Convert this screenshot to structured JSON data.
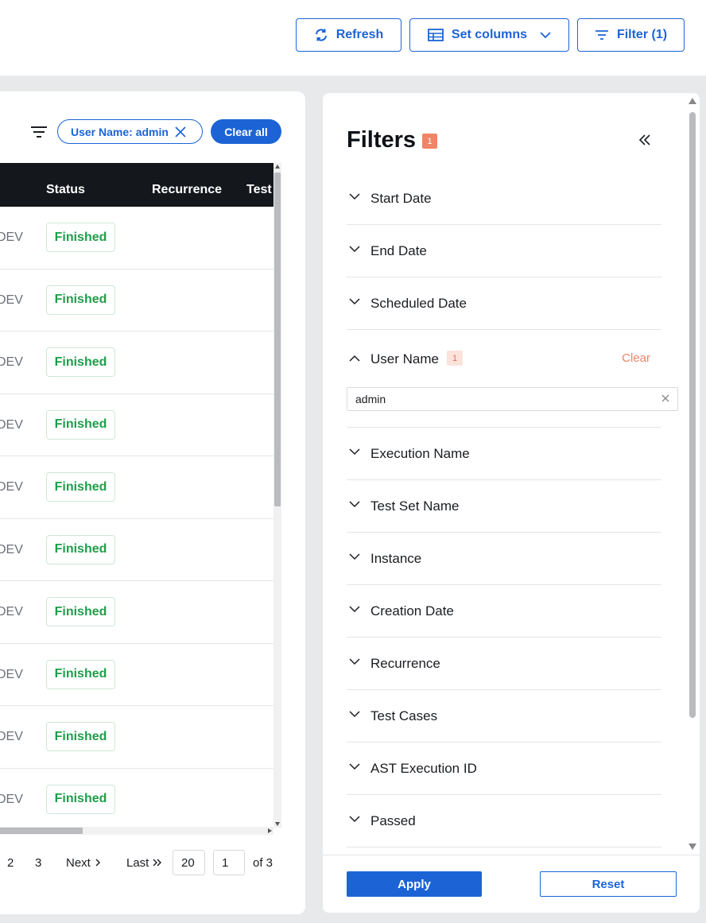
{
  "toolbar": {
    "refresh_label": "Refresh",
    "set_columns_label": "Set columns",
    "filter_label": "Filter (1)"
  },
  "table": {
    "active_filter_chip": "User Name: admin",
    "clear_all_label": "Clear all",
    "columns": [
      "Status",
      "Recurrence",
      "Test"
    ],
    "rows": [
      {
        "instance": "DEV",
        "status": "Finished"
      },
      {
        "instance": "DEV",
        "status": "Finished"
      },
      {
        "instance": "DEV",
        "status": "Finished"
      },
      {
        "instance": "DEV",
        "status": "Finished"
      },
      {
        "instance": "DEV",
        "status": "Finished"
      },
      {
        "instance": "DEV",
        "status": "Finished"
      },
      {
        "instance": "DEV",
        "status": "Finished"
      },
      {
        "instance": "DEV",
        "status": "Finished"
      },
      {
        "instance": "DEV",
        "status": "Finished"
      },
      {
        "instance": "DEV",
        "status": "Finished"
      }
    ]
  },
  "pagination": {
    "pages": [
      "2",
      "3"
    ],
    "next_label": "Next",
    "last_label": "Last",
    "page_size": "20",
    "current_page": "1",
    "of_label": "of 3"
  },
  "filters_panel": {
    "title": "Filters",
    "count": "1",
    "items": [
      {
        "label": "Start Date",
        "expanded": false
      },
      {
        "label": "End Date",
        "expanded": false
      },
      {
        "label": "Scheduled Date",
        "expanded": false
      },
      {
        "label": "User Name",
        "expanded": true,
        "count": "1",
        "clear_label": "Clear",
        "value": "admin"
      },
      {
        "label": "Execution Name",
        "expanded": false
      },
      {
        "label": "Test Set Name",
        "expanded": false
      },
      {
        "label": "Instance",
        "expanded": false
      },
      {
        "label": "Creation Date",
        "expanded": false
      },
      {
        "label": "Recurrence",
        "expanded": false
      },
      {
        "label": "Test Cases",
        "expanded": false
      },
      {
        "label": "AST Execution ID",
        "expanded": false
      },
      {
        "label": "Passed",
        "expanded": false
      }
    ],
    "apply_label": "Apply",
    "reset_label": "Reset"
  },
  "colors": {
    "primary": "#1c64d6",
    "success": "#1f9d4a",
    "accent": "#f08466",
    "header_bg": "#14171c"
  }
}
